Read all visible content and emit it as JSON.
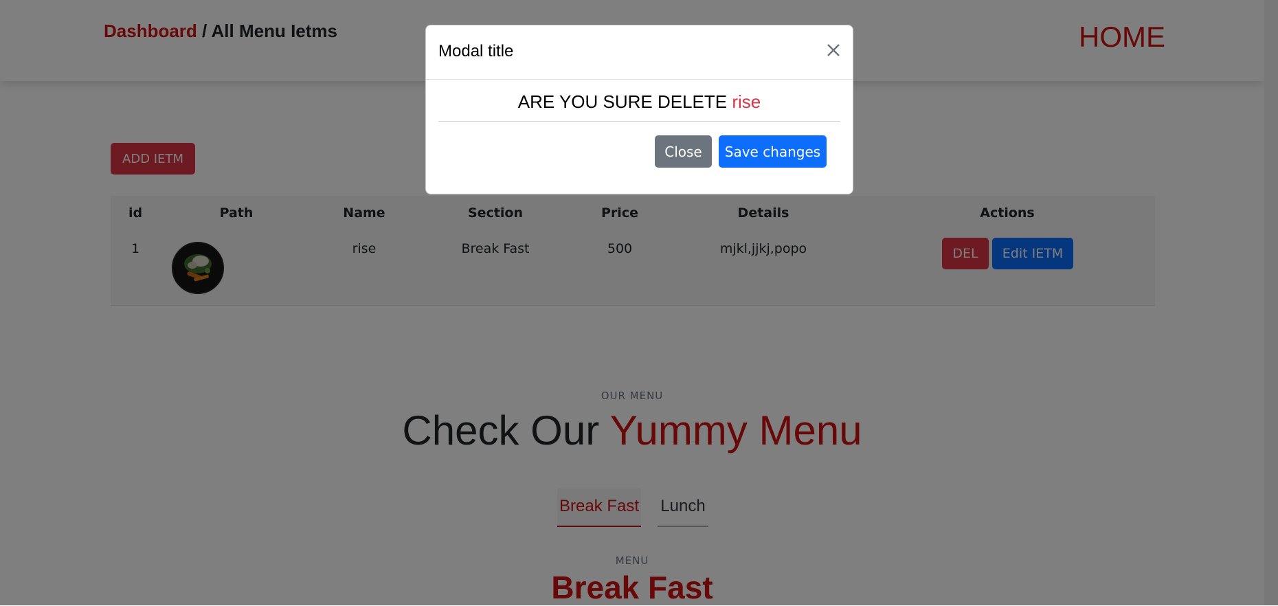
{
  "header": {
    "breadcrumb_home": "Dashboard",
    "breadcrumb_sep": " / ",
    "breadcrumb_current": "All Menu Ietms",
    "home_link": "HOME"
  },
  "toolbar": {
    "add_label": "ADD IETM"
  },
  "table": {
    "columns": [
      "id",
      "Path",
      "Name",
      "Section",
      "Price",
      "Details",
      "Actions"
    ],
    "rows": [
      {
        "id": "1",
        "name": "rise",
        "section": "Break Fast",
        "price": "500",
        "details": "mjkl,jjkj,popo",
        "del_label": "DEL",
        "edit_label": "Edit IETM"
      }
    ]
  },
  "menu": {
    "small_label": "OUR MENU",
    "heading_main": "Check Our ",
    "heading_accent": "Yummy Menu",
    "tabs": [
      "Break Fast",
      "Lunch"
    ],
    "active_tab": "Break Fast",
    "section_small": "MENU",
    "section_title": "Break Fast"
  },
  "modal": {
    "title": "Modal title",
    "confirm_text": "ARE YOU SURE DELETE ",
    "item_name": "rise",
    "close_label": "Close",
    "save_label": "Save changes"
  },
  "colors": {
    "accent": "#ce1212",
    "danger": "#dc3545",
    "primary": "#0d6efd",
    "secondary": "#6c757d"
  }
}
